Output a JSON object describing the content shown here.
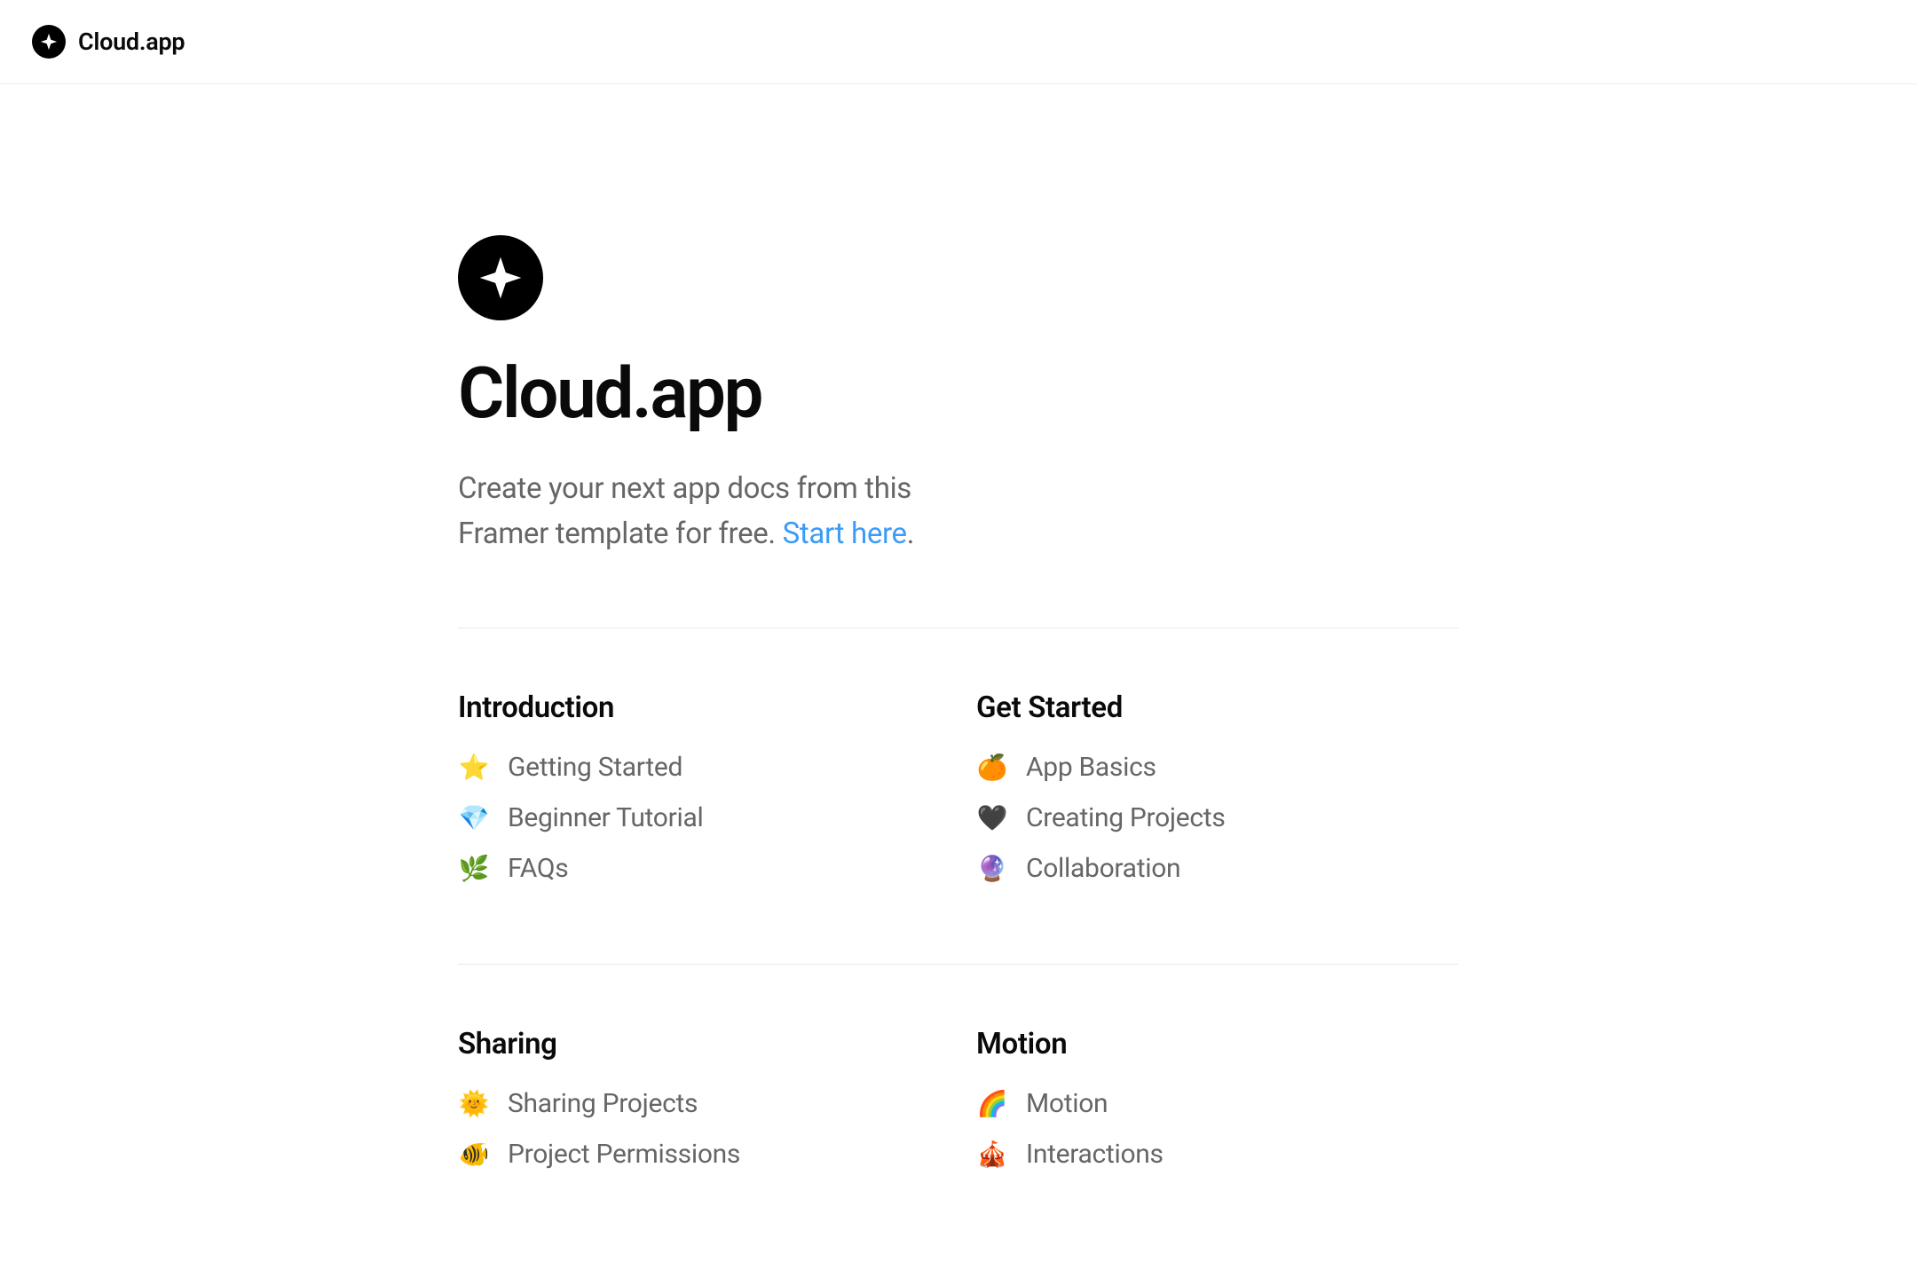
{
  "header": {
    "brand": "Cloud.app"
  },
  "hero": {
    "title": "Cloud.app",
    "subtitle_prefix": "Create your next app docs from this Framer template for free. ",
    "link_text": "Start here",
    "subtitle_suffix": "."
  },
  "sections": [
    {
      "title": "Introduction",
      "links": [
        {
          "emoji": "⭐",
          "label": "Getting Started"
        },
        {
          "emoji": "💎",
          "label": "Beginner Tutorial"
        },
        {
          "emoji": "🌿",
          "label": "FAQs"
        }
      ]
    },
    {
      "title": "Get Started",
      "links": [
        {
          "emoji": "🍊",
          "label": "App Basics"
        },
        {
          "emoji": "🖤",
          "label": "Creating Projects"
        },
        {
          "emoji": "🔮",
          "label": "Collaboration"
        }
      ]
    },
    {
      "title": "Sharing",
      "links": [
        {
          "emoji": "🌞",
          "label": "Sharing Projects"
        },
        {
          "emoji": "🐠",
          "label": "Project Permissions"
        }
      ]
    },
    {
      "title": "Motion",
      "links": [
        {
          "emoji": "🌈",
          "label": "Motion"
        },
        {
          "emoji": "🎪",
          "label": "Interactions"
        }
      ]
    }
  ]
}
